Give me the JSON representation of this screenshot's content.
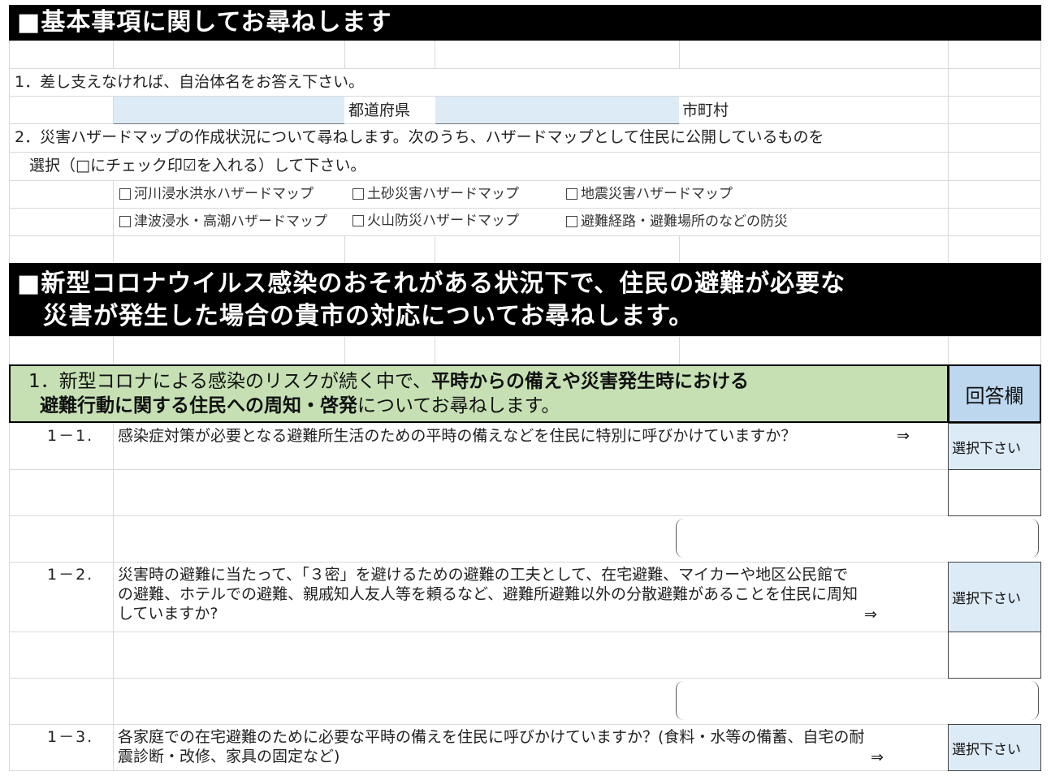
{
  "section1": {
    "header": "■基本事項に関してお尋ねします",
    "q1_text": "1．差し支えなければ、自治体名をお答え下さい。",
    "prefecture_label": "都道府県",
    "city_label": "市町村",
    "q2_line1": "2．災害ハザードマップの作成状況について尋ねします。次のうち、ハザードマップとして住民に公開しているものを",
    "q2_line2": "選択（□にチェック印☑を入れる）して下さい。",
    "checkboxes": [
      "河川浸水洪水ハザードマップ",
      "土砂災害ハザードマップ",
      "地震災害ハザードマップ",
      "津波浸水・高潮ハザードマップ",
      "火山防災ハザードマップ",
      "避難経路・避難場所のなどの防災"
    ]
  },
  "section2": {
    "header_line1": "■新型コロナウイルス感染のおそれがある状況下で、住民の避難が必要な",
    "header_line2": "災害が発生した場合の貴市の対応についてお尋ねします。",
    "green_line1_a": "1．新型コロナによる感染のリスクが続く中で、",
    "green_line1_b": "平時からの備えや災害発生時における",
    "green_line2_a": "避難行動に関する住民への周知・啓発",
    "green_line2_b": "についてお尋ねします。",
    "answer_header": "回答欄",
    "select_label": "選択下さい",
    "arrow": "⇒",
    "questions": [
      {
        "num": "1－1.",
        "lines": [
          "感染症対策が必要となる避難所生活のための平時の備えなどを住民に特別に呼びかけていますか？"
        ]
      },
      {
        "num": "1－2.",
        "lines": [
          "災害時の避難に当たって、「３密」を避けるための避難の工夫として、在宅避難、マイカーや地区公民館で",
          "の避難、ホテルでの避難、親戚知人友人等を頼るなど、避難所避難以外の分散避難があることを住民に周知",
          "していますか?"
        ]
      },
      {
        "num": "1－3.",
        "lines": [
          "各家庭での在宅避難のために必要な平時の備えを住民に呼びかけていますか？(食料・水等の備蓄、自宅の耐",
          "震診断・改修、家具の固定など)"
        ]
      }
    ]
  }
}
